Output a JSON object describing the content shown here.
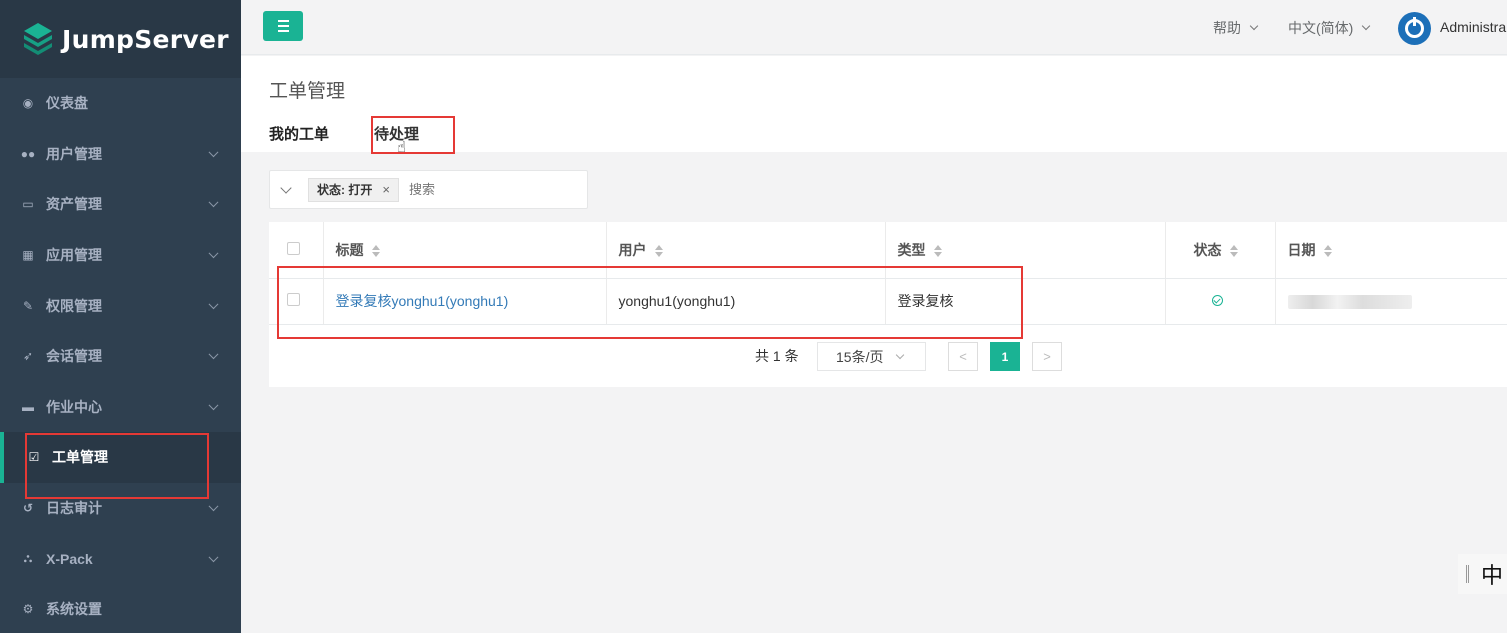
{
  "app": {
    "name": "JumpServer"
  },
  "sidebar": {
    "items": [
      {
        "label": "仪表盘",
        "icon": "dashboard-icon",
        "has_children": false
      },
      {
        "label": "用户管理",
        "icon": "users-icon",
        "has_children": true
      },
      {
        "label": "资产管理",
        "icon": "inbox-icon",
        "has_children": true
      },
      {
        "label": "应用管理",
        "icon": "grid-icon",
        "has_children": true
      },
      {
        "label": "权限管理",
        "icon": "edit-icon",
        "has_children": true
      },
      {
        "label": "会话管理",
        "icon": "rocket-icon",
        "has_children": true
      },
      {
        "label": "作业中心",
        "icon": "coffee-icon",
        "has_children": true
      },
      {
        "label": "工单管理",
        "icon": "check-square-icon",
        "has_children": false,
        "active": true
      },
      {
        "label": "日志审计",
        "icon": "history-icon",
        "has_children": true
      },
      {
        "label": "X-Pack",
        "icon": "sitemap-icon",
        "has_children": true
      },
      {
        "label": "系统设置",
        "icon": "gears-icon",
        "has_children": false
      }
    ]
  },
  "topbar": {
    "help": "帮助",
    "language": "中文(简体)",
    "user": "Administra"
  },
  "page": {
    "title": "工单管理",
    "tabs": [
      {
        "label": "我的工单"
      },
      {
        "label": "待处理"
      }
    ]
  },
  "filter": {
    "tag": "状态: 打开",
    "tag_close": "×",
    "search_placeholder": "搜索"
  },
  "table": {
    "headers": [
      "标题",
      "用户",
      "类型",
      "状态",
      "日期"
    ],
    "rows": [
      {
        "title": "登录复核yonghu1(yonghu1)",
        "user": "yonghu1(yonghu1)",
        "type": "登录复核",
        "status": "ok"
      }
    ]
  },
  "pagination": {
    "total": "共 1 条",
    "page_size": "15条/页",
    "prev": "<",
    "current": "1",
    "next": ">"
  },
  "ime": {
    "label": "中"
  },
  "colors": {
    "sidebar_bg": "#2f4050",
    "accent": "#1ab394",
    "link": "#337ab7",
    "highlight": "#e53935"
  }
}
